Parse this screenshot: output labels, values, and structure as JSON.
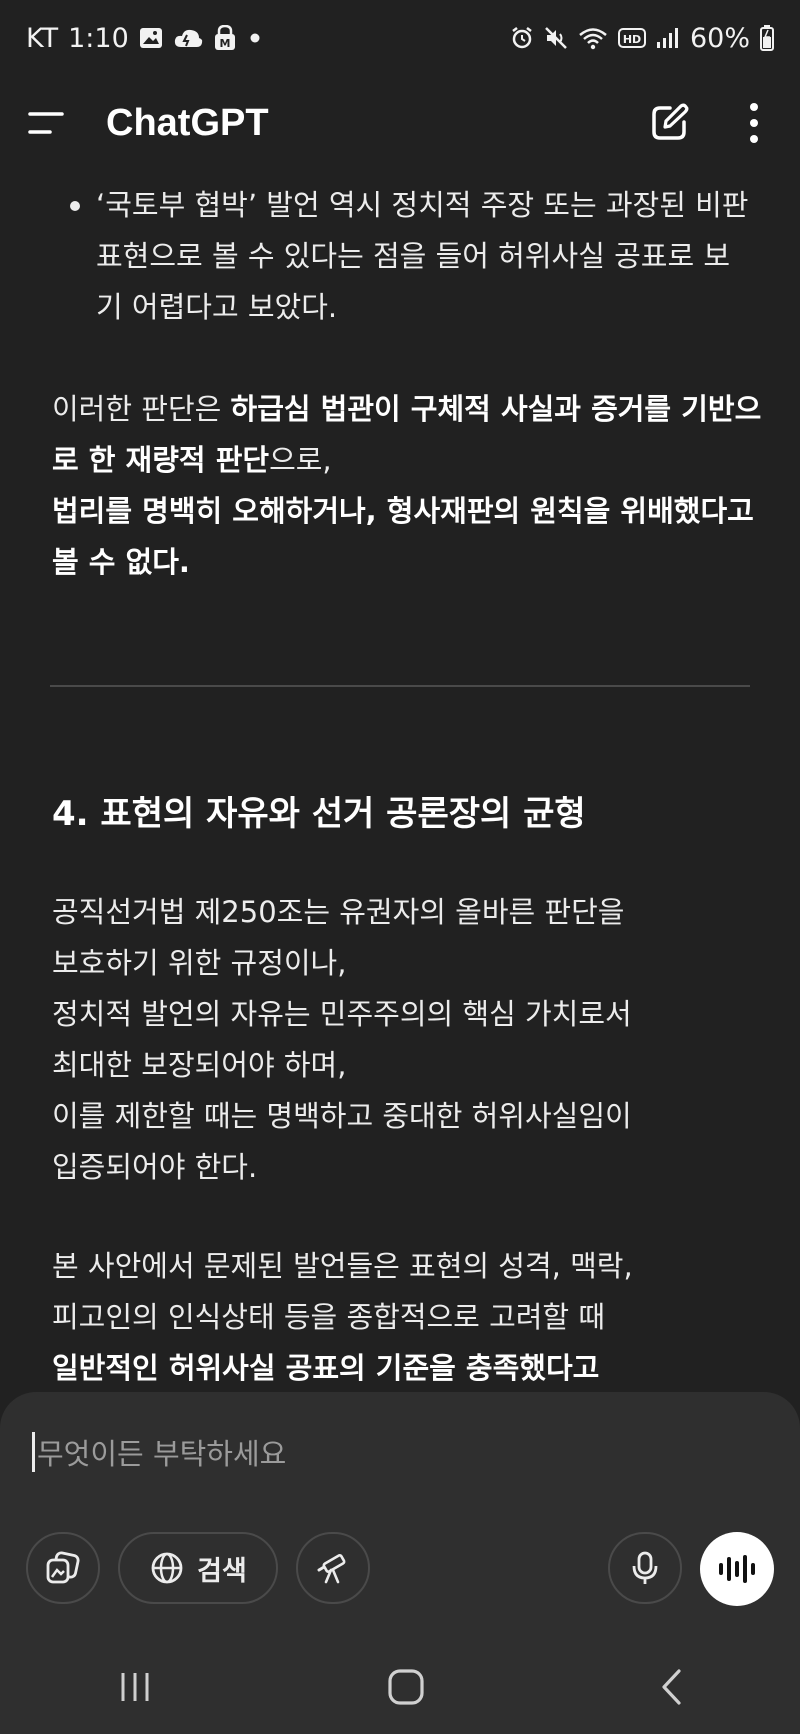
{
  "status_bar": {
    "carrier": "KT",
    "time": "1:10",
    "battery": "60%",
    "icons": [
      "gallery-icon",
      "weather-icon",
      "lock-app-icon",
      "notification-dot-icon",
      "alarm-icon",
      "mute-icon",
      "wifi-icon",
      "hd-voice-icon",
      "signal-icon",
      "battery-charging-icon"
    ]
  },
  "header": {
    "title": "ChatGPT",
    "icons": [
      "menu-icon",
      "new-chat-icon",
      "more-options-icon"
    ]
  },
  "message": {
    "bullet": "‘국토부 협박’ 발언 역시 정치적 주장 또는 과장된 비판 표현으로 볼 수 있다는 점을 들어 허위사실 공표로 보기 어렵다고 보았다.",
    "para1": {
      "t1": "이러한 판단은 ",
      "b1": "하급심 법관이 구체적 사실과 증거를 기반으로 한 재량적 판단",
      "t2": "으로,",
      "b2": "법리를 명백히 오해하거나, 형사재판의 원칙을 위배했다고 볼 수 없다."
    },
    "section_heading": "4. 표현의 자유와 선거 공론장의 균형",
    "para2": {
      "l1": "공직선거법 제250조는 유권자의 올바른 판단을",
      "l2": "보호하기 위한 규정이나,",
      "l3": "정치적 발언의 자유는 민주주의의 핵심 가치로서",
      "l4": "최대한 보장되어야 하며,",
      "l5": "이를 제한할 때는 명백하고 중대한 허위사실임이",
      "l6": "입증되어야 한다."
    },
    "para3": {
      "l1": "본 사안에서 문제된 발언들은 표현의 성격, 맥락,",
      "l2": "피고인의 인식상태 등을 종합적으로 고려할 때",
      "b1": "일반적인 허위사실 공표의 기준을 충족했다고"
    }
  },
  "composer": {
    "placeholder": "무엇이든 부탁하세요",
    "search_label": "검색",
    "icons": [
      "attach-icon",
      "globe-icon",
      "telescope-icon",
      "microphone-icon",
      "voice-mode-icon"
    ]
  },
  "nav_bar": {
    "icons": [
      "recent-apps-icon",
      "home-icon",
      "back-icon"
    ]
  },
  "colors": {
    "background": "#212121",
    "composer_bg": "#2f2f2f",
    "text": "#ececec",
    "placeholder": "#9b9b9b",
    "divider": "#4a4a4a"
  }
}
